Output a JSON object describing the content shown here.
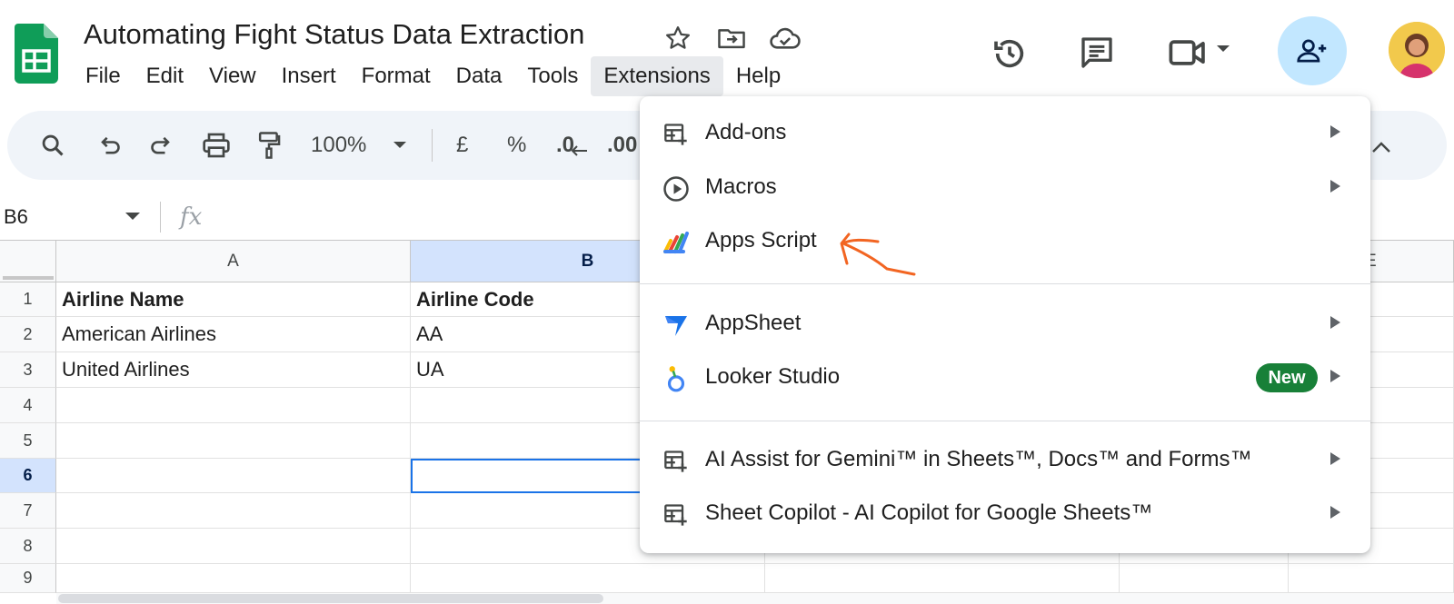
{
  "header": {
    "doc_title": "Automating Fight Status Data Extraction",
    "menu": [
      "File",
      "Edit",
      "View",
      "Insert",
      "Format",
      "Data",
      "Tools",
      "Extensions",
      "Help"
    ],
    "active_menu": "Extensions"
  },
  "toolbar": {
    "zoom": "100%",
    "currency": "£",
    "percent": "%",
    "decrease_decimal": ".0",
    "increase_decimal": ".00"
  },
  "formula_bar": {
    "cell_ref": "B6",
    "fx": "fx"
  },
  "grid": {
    "columns": [
      "A",
      "B",
      "E"
    ],
    "selected_column": "B",
    "rows": [
      "1",
      "2",
      "3",
      "4",
      "5",
      "6",
      "7",
      "8",
      "9"
    ],
    "selected_row": "6",
    "cells": {
      "A1": "Airline Name",
      "B1": "Airline Code",
      "A2": "American Airlines",
      "B2": "AA",
      "A3": "United Airlines",
      "B3": "UA"
    }
  },
  "dropdown": {
    "items": [
      {
        "label": "Add-ons",
        "icon": "add-table-icon",
        "submenu": true
      },
      {
        "label": "Macros",
        "icon": "play-circle-icon",
        "submenu": true
      },
      {
        "label": "Apps Script",
        "icon": "apps-script-icon",
        "submenu": false
      },
      {
        "label": "AppSheet",
        "icon": "appsheet-icon",
        "submenu": true
      },
      {
        "label": "Looker Studio",
        "icon": "looker-studio-icon",
        "submenu": true,
        "badge": "New"
      },
      {
        "label": "AI Assist for Gemini™ in Sheets™, Docs™ and Forms™",
        "icon": "add-table-icon",
        "submenu": true
      },
      {
        "label": "Sheet Copilot - AI Copilot for Google Sheets™",
        "icon": "add-table-icon",
        "submenu": true
      }
    ]
  },
  "colors": {
    "sheets_green": "#0f9d58",
    "selection_blue": "#1a73e8",
    "header_selected": "#d3e3fd",
    "share_bg": "#c2e7ff",
    "badge_green": "#188038",
    "annotation_orange": "#f26522"
  }
}
